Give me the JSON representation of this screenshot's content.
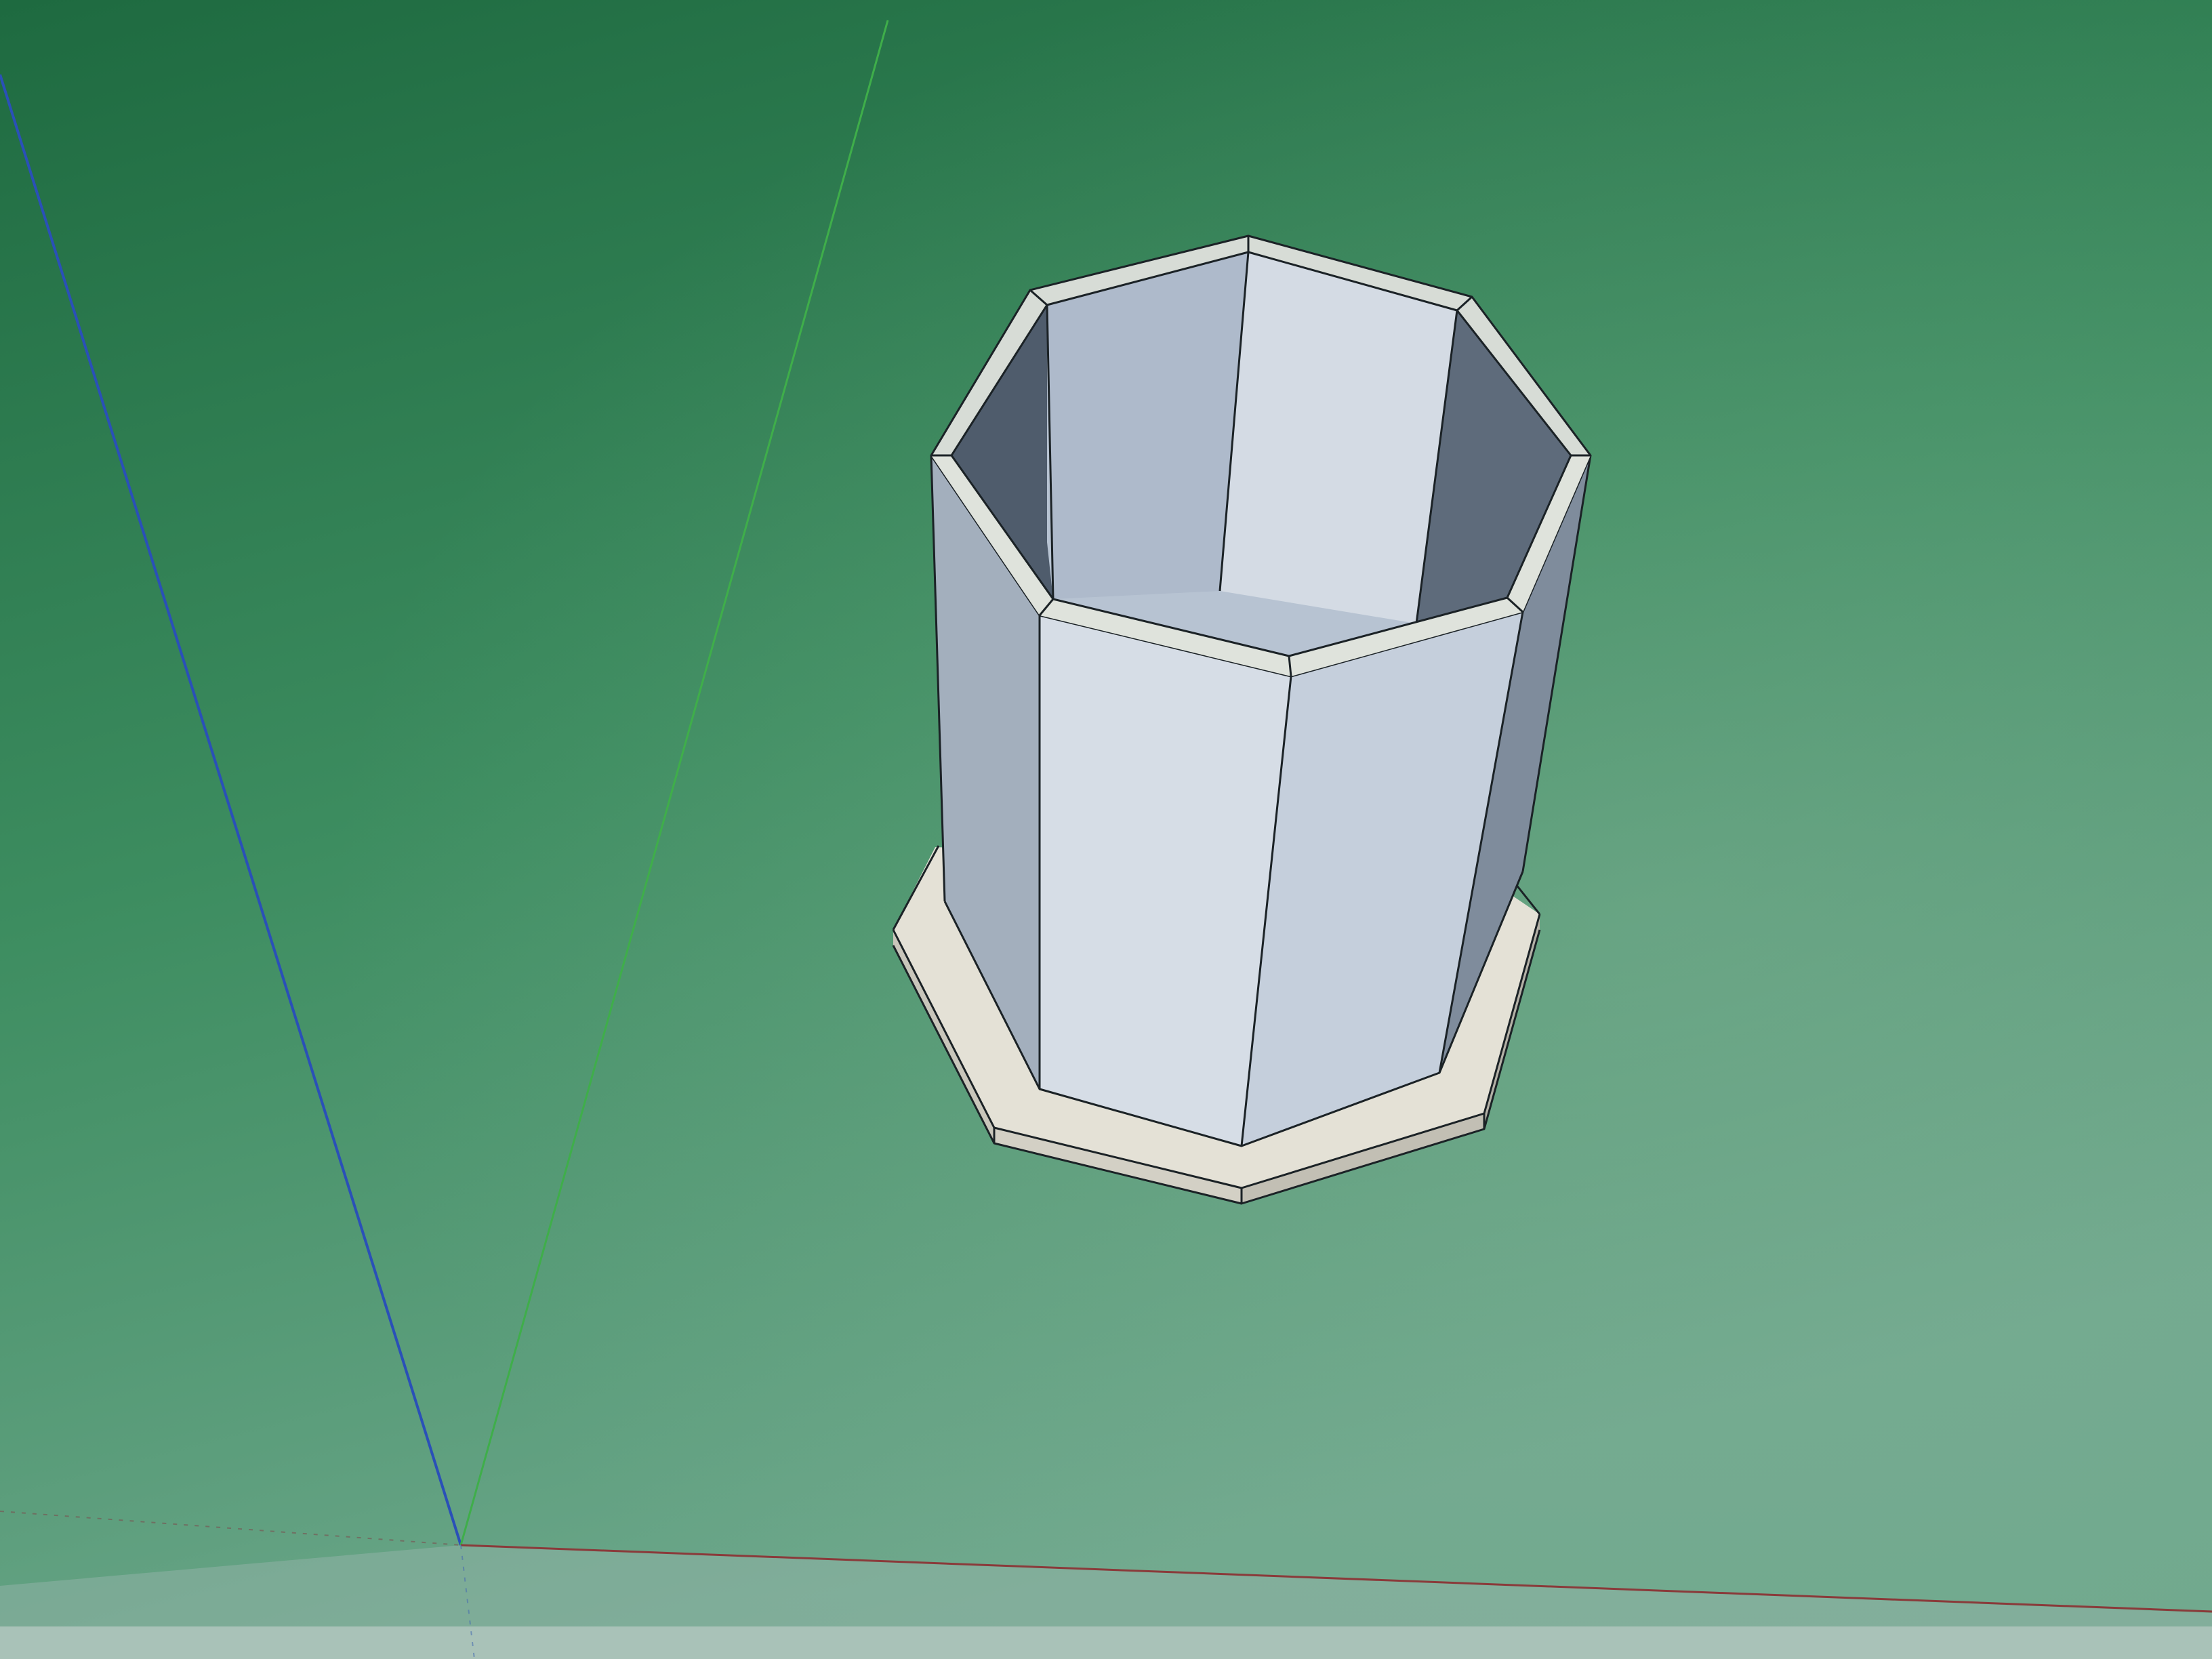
{
  "viewport": {
    "background_top": "#1e6a40",
    "background_mid": "#3d8d60",
    "background_bottom": "#6fa88d",
    "screen_bottom_band": "#a9c2b8"
  },
  "axes": {
    "blue_axis_color": "#2a50b8",
    "green_axis_color": "#3fae4a",
    "red_axis_color": "#8a3a3a"
  },
  "model": {
    "shape": "octagonal-cup-with-base-plate",
    "rim_color": "#d7dcd6",
    "outer_wall_light": "#d6dde6",
    "outer_wall_mid": "#c5cfdc",
    "outer_wall_dark": "#8c99a8",
    "inner_wall_light": "#d4dbe4",
    "inner_wall_mid": "#b7c3d2",
    "inner_wall_dark": "#5e6b7b",
    "base_top_color": "#e4e1d6",
    "base_side_color": "#c9c6bb",
    "edge_color": "#1b2226"
  }
}
